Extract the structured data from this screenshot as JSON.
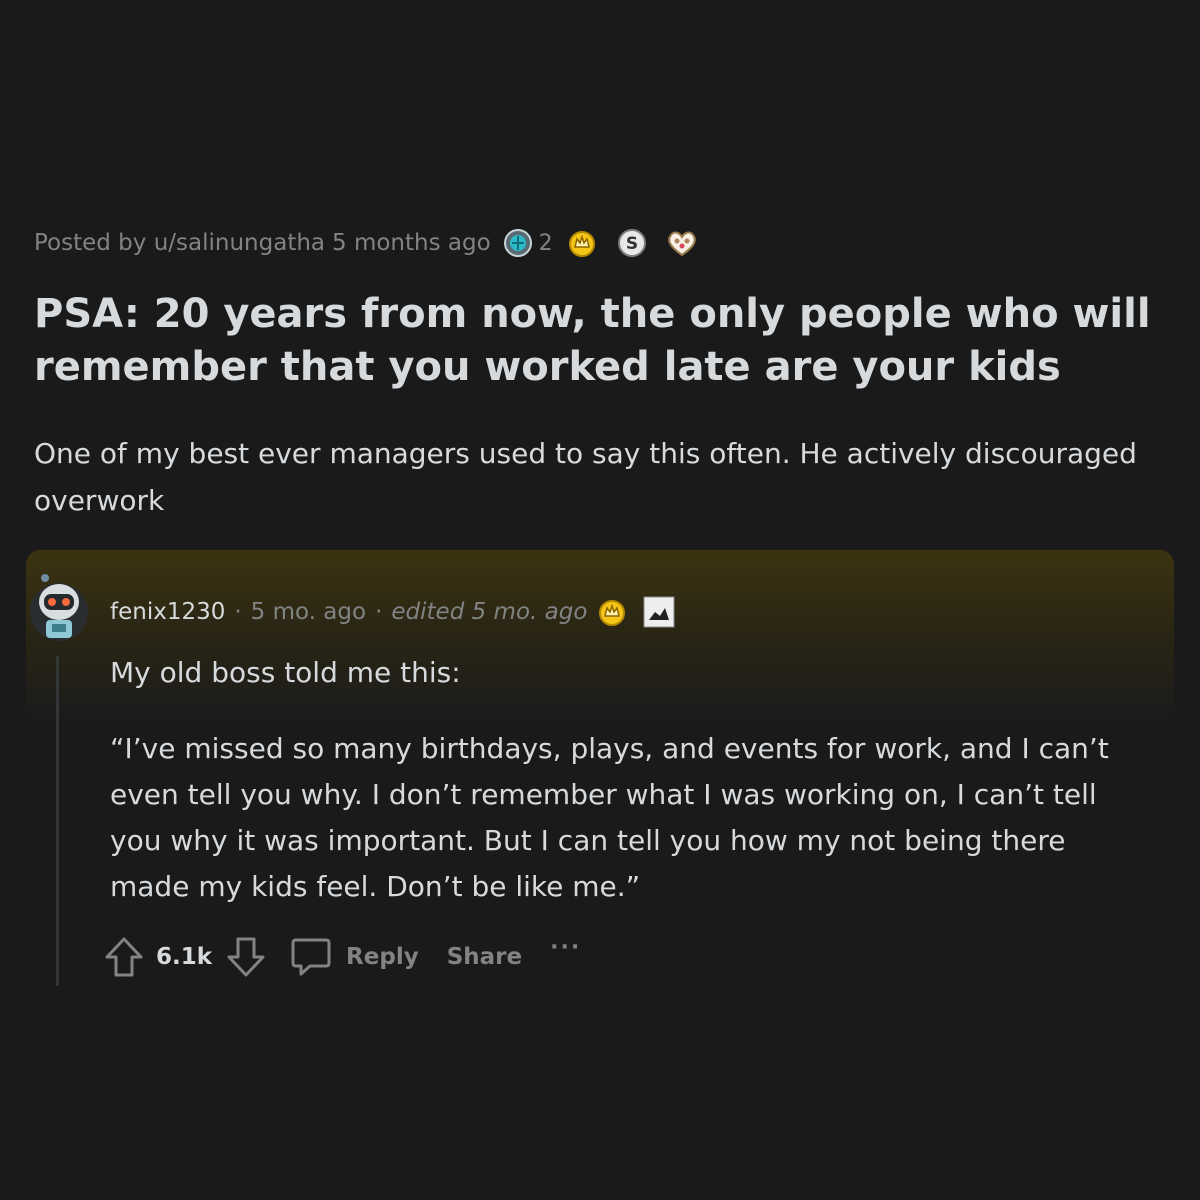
{
  "post": {
    "posted_by": "Posted by u/salinungatha",
    "time": "5 months ago",
    "award_count": "2",
    "awards": [
      "globe-award-icon",
      "gold-crown-award-icon",
      "silver-s-award-icon",
      "heart-paws-award-icon"
    ],
    "title": "PSA: 20 years from now, the only people who will remember that you worked late are your kids",
    "body": "One of my best ever managers used to say this often. He actively discouraged overwork"
  },
  "comment": {
    "author": "fenix1230",
    "time": "5 mo. ago",
    "edited": "edited 5 mo. ago",
    "paragraphs": [
      "My old boss told me this:",
      "“I’ve missed so many birthdays, plays, and events for work, and I can’t even tell you why. I don’t remember what I was working on, I can’t tell you why it was important. But I can tell you how my not being there made my kids feel. Don’t be like me.”"
    ],
    "votes": "6.1k",
    "reply_label": "Reply",
    "share_label": "Share",
    "more_label": "···"
  },
  "colors": {
    "background": "#1a1a1b",
    "text": "#d7dadc",
    "muted": "#818384",
    "highlight": "#3e3410",
    "award_gold": "#f5c518"
  }
}
